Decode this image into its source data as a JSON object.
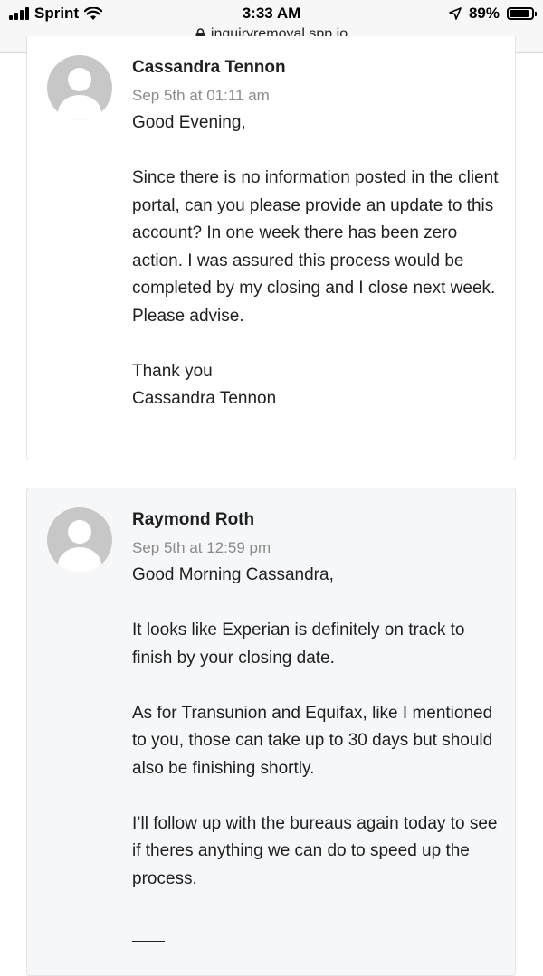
{
  "status_bar": {
    "carrier": "Sprint",
    "time": "3:33 AM",
    "battery": "89%",
    "battery_level": 0.89,
    "url": "inquiryremoval.spp.io"
  },
  "messages": [
    {
      "author": "Cassandra Tennon",
      "timestamp": "Sep 5th at 01:11 am",
      "paragraphs": [
        "Good Evening,",
        "Since there is no information posted in the client portal, can you please provide an update to this account? In one week there has been zero action. I was assured this process would be completed by my closing and I close next week. Please advise.",
        "Thank you\nCassandra Tennon"
      ]
    },
    {
      "author": "Raymond Roth",
      "timestamp": "Sep 5th at 12:59 pm",
      "paragraphs": [
        "Good Morning Cassandra,",
        "It looks like Experian is definitely on track to finish by your closing date.",
        "As for Transunion and Equifax, like I mentioned to you, those can take up to 30 days but should also be finishing shortly.",
        "I’ll follow up with the bureaus again today to see if theres anything we can do to speed up the process."
      ]
    }
  ]
}
